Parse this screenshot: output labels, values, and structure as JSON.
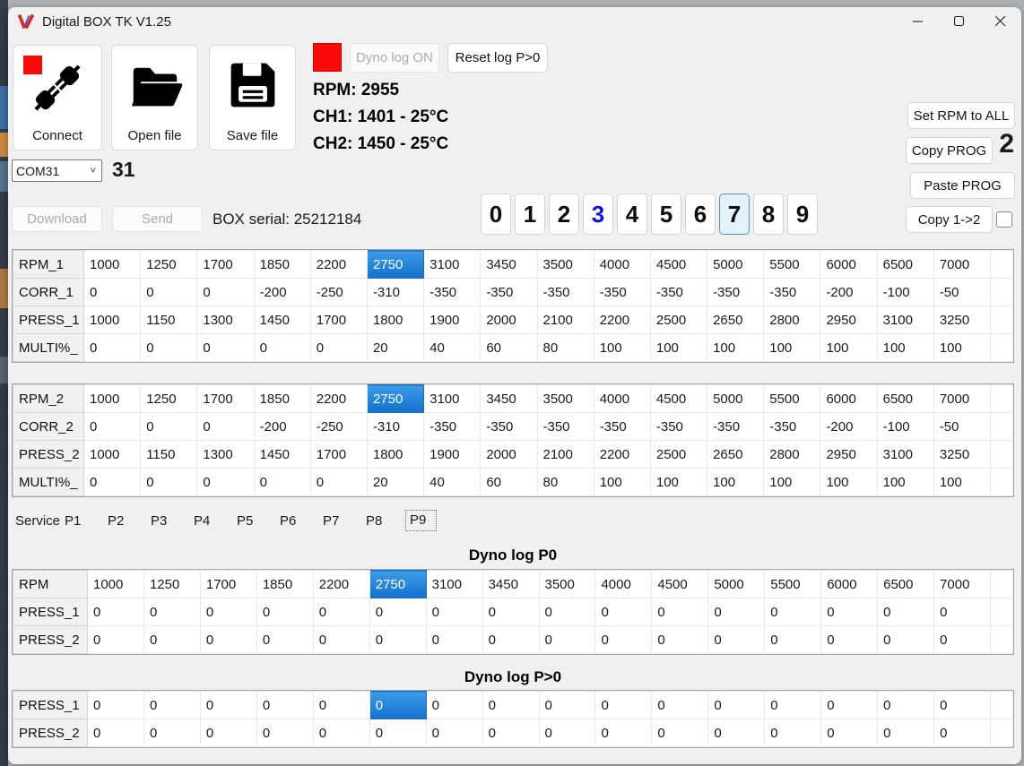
{
  "window": {
    "title": "Digital BOX TK V1.25"
  },
  "toolbar": {
    "connect_label": "Connect",
    "open_label": "Open file",
    "save_label": "Save file"
  },
  "dyno_controls": {
    "log_button": "Dyno log ON",
    "reset_button": "Reset log P>0"
  },
  "readouts": {
    "rpm": "RPM: 2955",
    "ch1": "CH1: 1401 - 25°C",
    "ch2": "CH2: 1450 - 25°C"
  },
  "comms": {
    "com_port": "COM31",
    "com_number": "31",
    "download_label": "Download",
    "send_label": "Send",
    "box_serial": "BOX serial: 25212184"
  },
  "prog_selector": {
    "digits": [
      "0",
      "1",
      "2",
      "3",
      "4",
      "5",
      "6",
      "7",
      "8",
      "9"
    ],
    "active_digit": "7",
    "blue_digit": "3"
  },
  "side_buttons": {
    "set_rpm": "Set RPM to ALL",
    "copy_prog": "Copy PROG",
    "copy_count": "2",
    "paste_prog": "Paste PROG",
    "copy_1_2": "Copy 1->2"
  },
  "tabs": {
    "items": [
      "Service",
      "P1",
      "P2",
      "P3",
      "P4",
      "P5",
      "P6",
      "P7",
      "P8",
      "P9"
    ],
    "selected": "P9"
  },
  "tables": {
    "prog1": {
      "selected": {
        "row": "RPM_1",
        "col": 5
      },
      "rows": [
        {
          "label": "RPM_1",
          "values": [
            1000,
            1250,
            1700,
            1850,
            2200,
            2750,
            3100,
            3450,
            3500,
            4000,
            4500,
            5000,
            5500,
            6000,
            6500,
            7000
          ]
        },
        {
          "label": "CORR_1",
          "values": [
            0,
            0,
            0,
            -200,
            -250,
            -310,
            -350,
            -350,
            -350,
            -350,
            -350,
            -350,
            -350,
            -200,
            -100,
            -50
          ]
        },
        {
          "label": "PRESS_1",
          "values": [
            1000,
            1150,
            1300,
            1450,
            1700,
            1800,
            1900,
            2000,
            2100,
            2200,
            2500,
            2650,
            2800,
            2950,
            3100,
            3250
          ]
        },
        {
          "label": "MULTI%_",
          "values": [
            0,
            0,
            0,
            0,
            0,
            20,
            40,
            60,
            80,
            100,
            100,
            100,
            100,
            100,
            100,
            100
          ]
        }
      ]
    },
    "prog2": {
      "selected": {
        "row": "RPM_2",
        "col": 5
      },
      "rows": [
        {
          "label": "RPM_2",
          "values": [
            1000,
            1250,
            1700,
            1850,
            2200,
            2750,
            3100,
            3450,
            3500,
            4000,
            4500,
            5000,
            5500,
            6000,
            6500,
            7000
          ]
        },
        {
          "label": "CORR_2",
          "values": [
            0,
            0,
            0,
            -200,
            -250,
            -310,
            -350,
            -350,
            -350,
            -350,
            -350,
            -350,
            -350,
            -200,
            -100,
            -50
          ]
        },
        {
          "label": "PRESS_2",
          "values": [
            1000,
            1150,
            1300,
            1450,
            1700,
            1800,
            1900,
            2000,
            2100,
            2200,
            2500,
            2650,
            2800,
            2950,
            3100,
            3250
          ]
        },
        {
          "label": "MULTI%_",
          "values": [
            0,
            0,
            0,
            0,
            0,
            20,
            40,
            60,
            80,
            100,
            100,
            100,
            100,
            100,
            100,
            100
          ]
        }
      ]
    },
    "dyno_p0": {
      "title": "Dyno log  P0",
      "selected": {
        "row": "RPM",
        "col": 5
      },
      "rows": [
        {
          "label": "RPM",
          "values": [
            1000,
            1250,
            1700,
            1850,
            2200,
            2750,
            3100,
            3450,
            3500,
            4000,
            4500,
            5000,
            5500,
            6000,
            6500,
            7000
          ]
        },
        {
          "label": "PRESS_1",
          "values": [
            0,
            0,
            0,
            0,
            0,
            0,
            0,
            0,
            0,
            0,
            0,
            0,
            0,
            0,
            0,
            0
          ]
        },
        {
          "label": "PRESS_2",
          "values": [
            0,
            0,
            0,
            0,
            0,
            0,
            0,
            0,
            0,
            0,
            0,
            0,
            0,
            0,
            0,
            0
          ]
        }
      ]
    },
    "dyno_pgt0": {
      "title": "Dyno log  P>0",
      "selected": {
        "row": "PRESS_1",
        "col": 5
      },
      "rows": [
        {
          "label": "PRESS_1",
          "values": [
            0,
            0,
            0,
            0,
            0,
            0,
            0,
            0,
            0,
            0,
            0,
            0,
            0,
            0,
            0,
            0
          ]
        },
        {
          "label": "PRESS_2",
          "values": [
            0,
            0,
            0,
            0,
            0,
            0,
            0,
            0,
            0,
            0,
            0,
            0,
            0,
            0,
            0,
            0
          ]
        }
      ]
    }
  },
  "icons": {
    "app": "v-logo-icon",
    "connect": "plug-icon",
    "open": "folder-icon",
    "save": "floppy-icon",
    "com_chevron": "chevron-down-icon"
  },
  "colors": {
    "selection_blue": "#1470cd",
    "indicator_red": "#fb0a0a",
    "digit_blue": "#0f0fee"
  }
}
